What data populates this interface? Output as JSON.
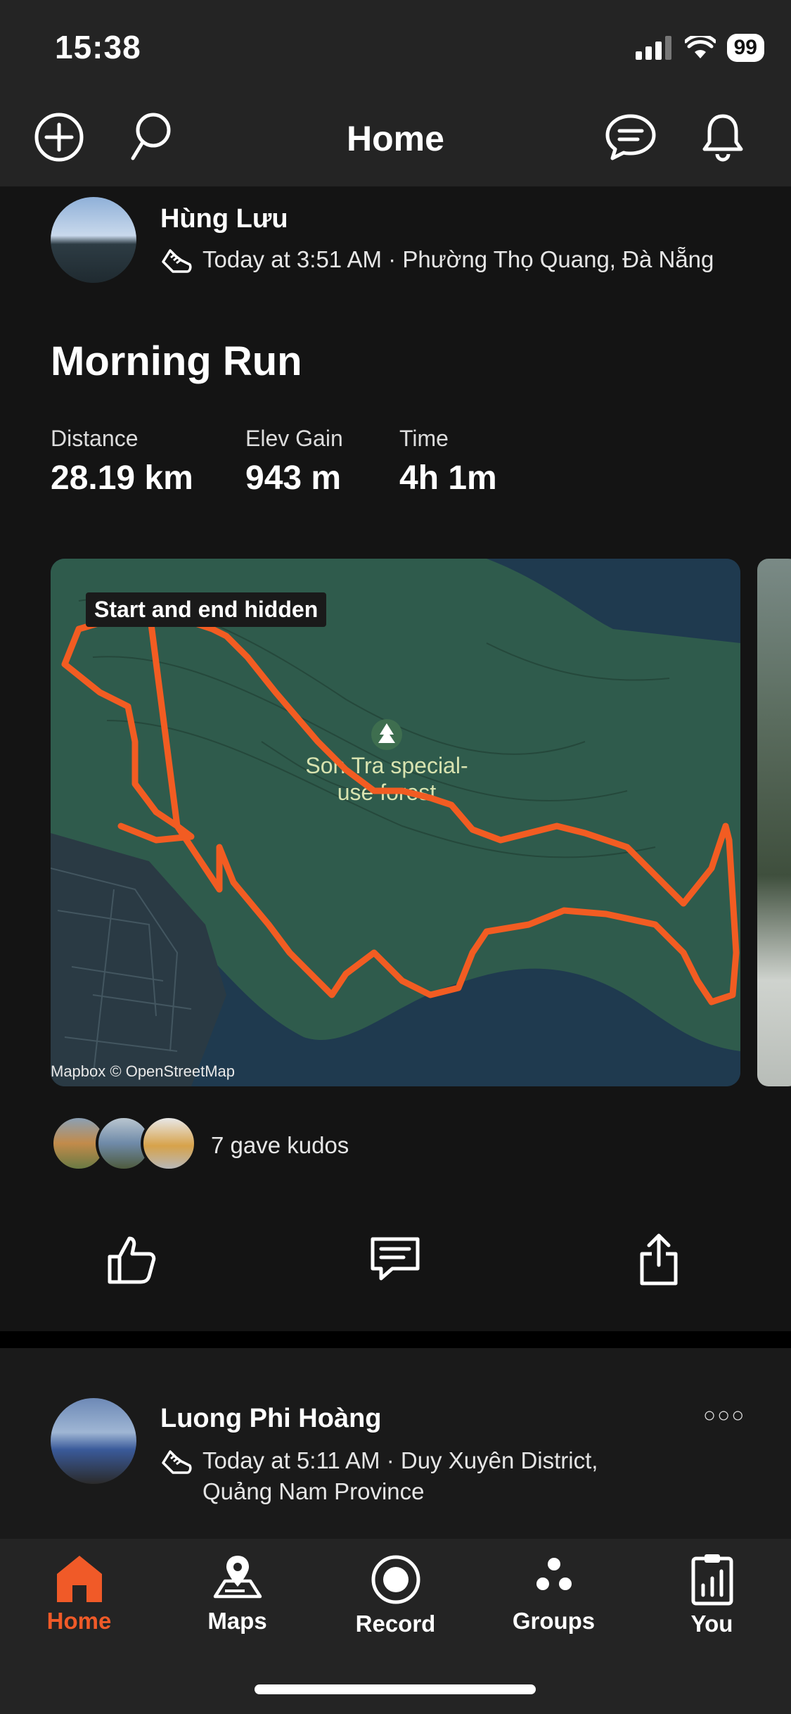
{
  "status_bar": {
    "time": "15:38",
    "battery": "99"
  },
  "header": {
    "title": "Home"
  },
  "post1": {
    "athlete_name": "Hùng Lưu",
    "meta": "Today at 3:51 AM · Phường Thọ Quang, Đà Nẵng",
    "activity_title": "Morning Run",
    "stats": [
      {
        "label": "Distance",
        "value": "28.19 km"
      },
      {
        "label": "Elev Gain",
        "value": "943 m"
      },
      {
        "label": "Time",
        "value": "4h 1m"
      }
    ],
    "map": {
      "badge": "Start and end hidden",
      "place_label_1": "Son Tra special-",
      "place_label_2": "use forest",
      "credit": "Mapbox © OpenStreetMap"
    },
    "kudos_text": "7 gave kudos"
  },
  "post2": {
    "athlete_name": "Luong Phi Hoàng",
    "meta_line1": "Today at 5:11 AM · Duy Xuyên District,",
    "meta_line2": "Quảng Nam Province",
    "more_label": "○○○"
  },
  "tabs": [
    {
      "label": "Home",
      "icon": "home-icon",
      "active": true
    },
    {
      "label": "Maps",
      "icon": "maps-icon",
      "active": false
    },
    {
      "label": "Record",
      "icon": "record-icon",
      "active": false
    },
    {
      "label": "Groups",
      "icon": "groups-icon",
      "active": false
    },
    {
      "label": "You",
      "icon": "you-icon",
      "active": false
    }
  ],
  "colors": {
    "accent": "#f05a28",
    "route": "#f25c22",
    "map_land": "#2f5b4c",
    "map_water": "#1f3a4f"
  }
}
